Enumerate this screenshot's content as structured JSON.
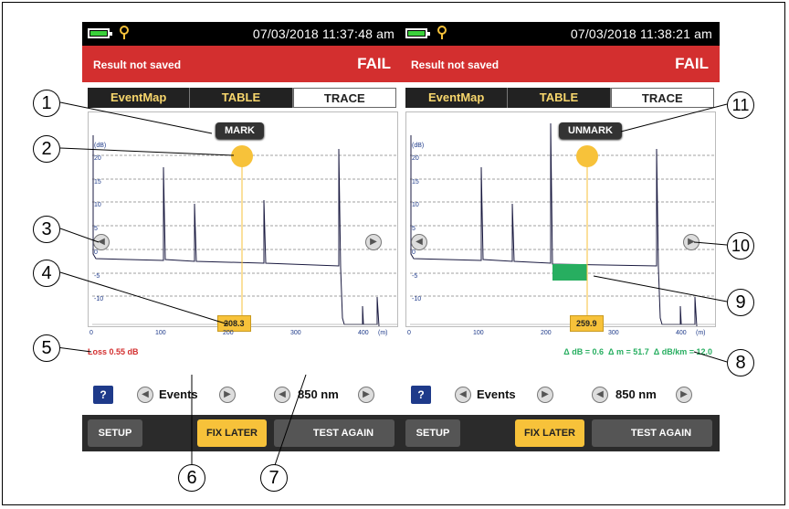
{
  "screen_left": {
    "status": {
      "datetime": "07/03/2018 11:37:48 am"
    },
    "result": {
      "message": "Result not saved",
      "status": "FAIL"
    },
    "tabs": [
      "EventMap",
      "TABLE",
      "TRACE"
    ],
    "mark_button": "MARK",
    "cursor_value": "208.3",
    "y_axis_unit": "(dB)",
    "y_ticks": [
      "20",
      "15",
      "10",
      "5",
      "0",
      "-5",
      "-10"
    ],
    "x_ticks": [
      "0",
      "100",
      "200",
      "300",
      "400"
    ],
    "x_axis_unit": "(m)",
    "loss_text": "Loss 0.55 dB",
    "controls": {
      "help": "?",
      "events_label": "Events",
      "wavelength": "850 nm"
    },
    "bottom": {
      "setup": "SETUP",
      "fix_later": "FIX LATER",
      "test_again": "TEST AGAIN"
    }
  },
  "screen_right": {
    "status": {
      "datetime": "07/03/2018 11:38:21 am"
    },
    "result": {
      "message": "Result not saved",
      "status": "FAIL"
    },
    "tabs": [
      "EventMap",
      "TABLE",
      "TRACE"
    ],
    "mark_button": "UNMARK",
    "cursor_value": "259.9",
    "y_axis_unit": "(dB)",
    "y_ticks": [
      "20",
      "15",
      "10",
      "5",
      "0",
      "-5",
      "-10"
    ],
    "x_ticks": [
      "0",
      "100",
      "200",
      "300",
      "400"
    ],
    "x_axis_unit": "(m)",
    "delta_text": "Δ dB = 0.6  Δ m = 51.7  Δ dB/km = 12.0",
    "controls": {
      "help": "?",
      "events_label": "Events",
      "wavelength": "850 nm"
    },
    "bottom": {
      "setup": "SETUP",
      "fix_later": "FIX LATER",
      "test_again": "TEST AGAIN"
    }
  },
  "callouts": [
    "1",
    "2",
    "3",
    "4",
    "5",
    "6",
    "7",
    "8",
    "9",
    "10",
    "11"
  ],
  "colors": {
    "fail_red": "#d32f2f",
    "marker_yellow": "#f7c23a",
    "green_region": "#27ae60",
    "tab_text": "#f7d66c"
  }
}
